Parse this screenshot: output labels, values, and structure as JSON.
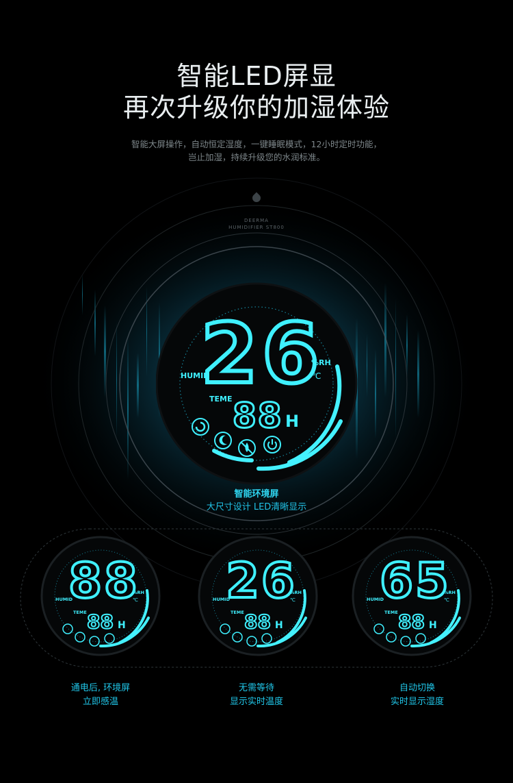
{
  "headline": {
    "line1": "智能LED屏显",
    "line2": "再次升级你的加湿体验"
  },
  "subtext": {
    "line1": "智能大屏操作，自动恒定湿度，一键睡眠模式，12小时定时功能，",
    "line2": "岂止加湿，持续升级您的水润标准。"
  },
  "product": {
    "brand": "DEERMA",
    "model": "HUMIDIFIER ST800"
  },
  "hero_display": {
    "main_value": "26",
    "timer_value": "88",
    "timer_unit": "H",
    "humid_label": "HUMID",
    "rh_label": "%RH",
    "celsius_label": "℃",
    "timer_label": "TEME",
    "icons": [
      "timer-icon",
      "sleep-mode-icon",
      "no-mist-icon",
      "power-icon"
    ]
  },
  "hero_caption": {
    "title": "智能环境屏",
    "subtitle": "大尺寸设计 LED清晰显示"
  },
  "variants": [
    {
      "value": "88",
      "timer": "88",
      "unit": "H",
      "humid": "HUMID",
      "rh": "%RH",
      "c": "℃",
      "teme": "TEME",
      "caption1": "通电后, 环境屏",
      "caption2": "立即感温"
    },
    {
      "value": "26",
      "timer": "88",
      "unit": "H",
      "humid": "HUMID",
      "rh": "%RH",
      "c": "℃",
      "teme": "TEME",
      "caption1": "无需等待",
      "caption2": "显示实时温度"
    },
    {
      "value": "65",
      "timer": "88",
      "unit": "H",
      "humid": "HUMID",
      "rh": "%RH",
      "c": "℃",
      "teme": "TEME",
      "caption1": "自动切换",
      "caption2": "实时显示湿度"
    }
  ],
  "colors": {
    "accent": "#3ff0ff",
    "accent_dim": "#1bb6d6",
    "background": "#000000"
  }
}
